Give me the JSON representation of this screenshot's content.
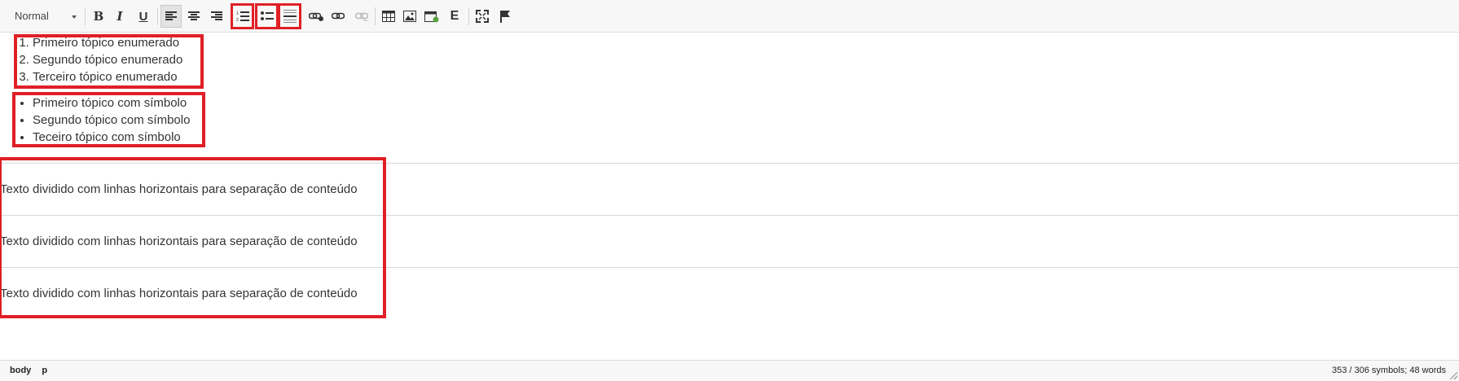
{
  "toolbar": {
    "format_value": "Normal",
    "bold_label": "B",
    "italic_label": "I",
    "underline_label": "U",
    "blocks_label": "E"
  },
  "content": {
    "numbered_list": [
      "Primeiro tópico enumerado",
      "Segundo tópico enumerado",
      "Terceiro tópico enumerado"
    ],
    "bullet_list": [
      "Primeiro tópico com símbolo",
      "Segundo tópico com símbolo",
      "Teceiro tópico com símbolo"
    ],
    "paragraphs": [
      "Texto dividido com linhas horizontais para separação de conteúdo",
      "Texto dividido com linhas horizontais para separação de conteúdo",
      "Texto dividido com linhas horizontais para separação de conteúdo"
    ]
  },
  "statusbar": {
    "path": [
      "body",
      "p"
    ],
    "counts": "353 / 306 symbols; 48 words"
  },
  "colors": {
    "highlight": "#e01f26",
    "toolbar_bg": "#f7f7f7"
  }
}
